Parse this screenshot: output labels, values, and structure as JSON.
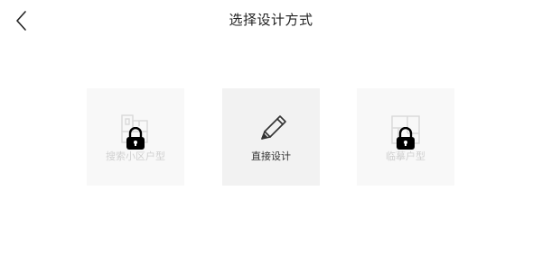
{
  "header": {
    "back_icon": "chevron-left-icon",
    "title": "选择设计方式"
  },
  "options": [
    {
      "label": "搜索小区户型",
      "icon": "floorplan-icon",
      "locked": true,
      "lock_icon": "lock-icon"
    },
    {
      "label": "直接设计",
      "icon": "pencil-icon",
      "locked": false
    },
    {
      "label": "临摹户型",
      "icon": "blueprint-icon",
      "locked": true,
      "lock_icon": "lock-icon"
    }
  ],
  "colors": {
    "card_bg": "#f8f8f8",
    "card_active_bg": "#f2f2f2",
    "text_primary": "#222222",
    "text_disabled": "#d0d0d0",
    "lock": "#000000"
  }
}
